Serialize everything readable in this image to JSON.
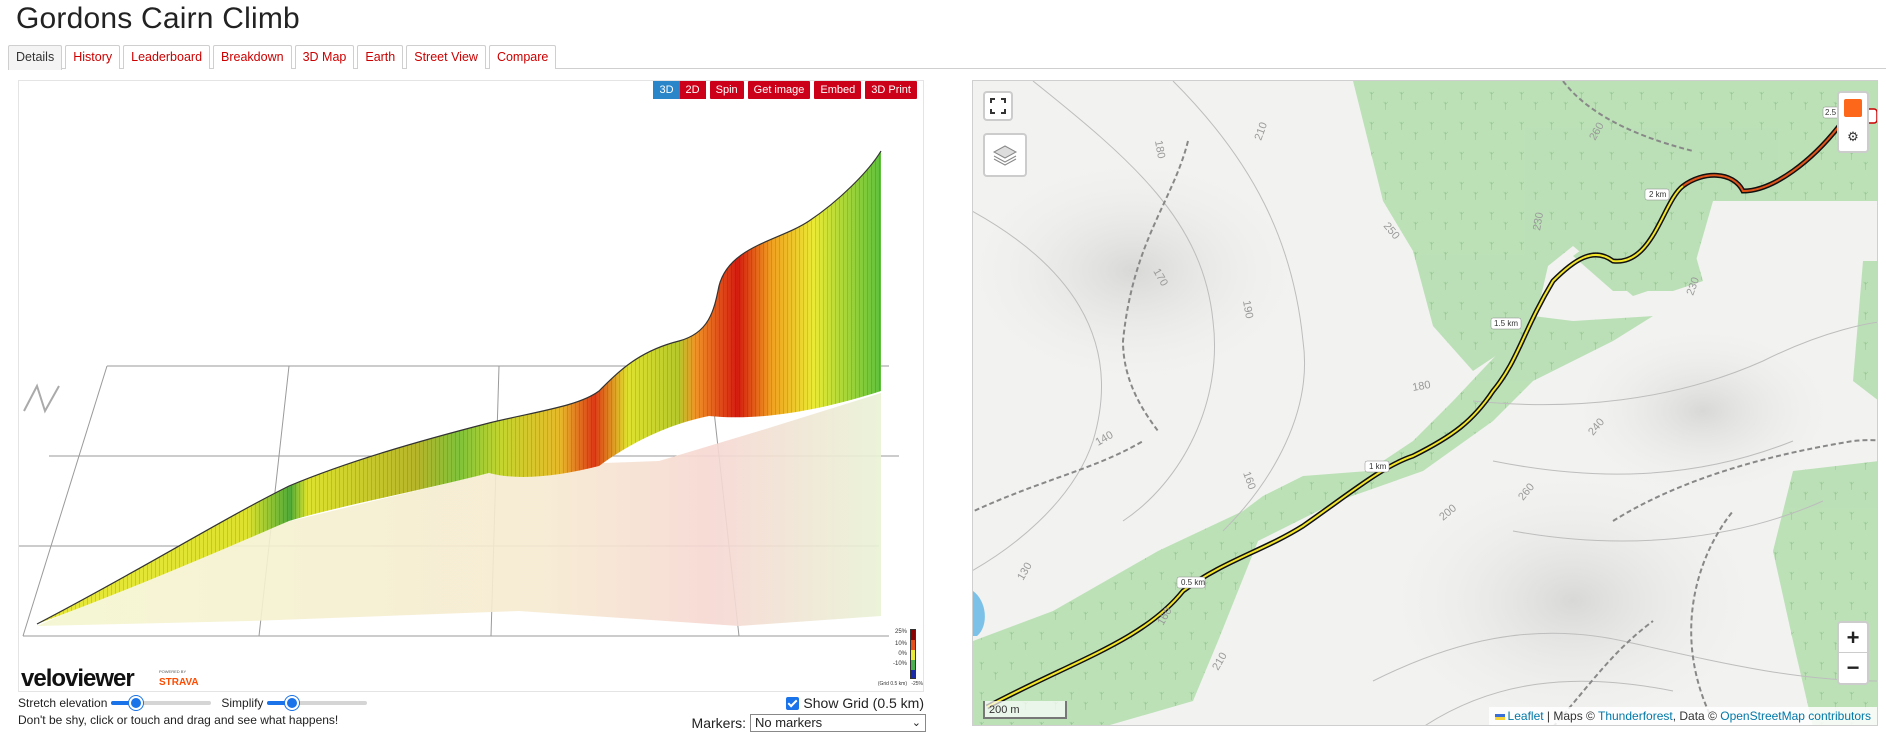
{
  "page": {
    "title": "Gordons Cairn Climb"
  },
  "tabs": [
    {
      "label": "Details",
      "active": true
    },
    {
      "label": "History"
    },
    {
      "label": "Leaderboard"
    },
    {
      "label": "Breakdown"
    },
    {
      "label": "3D Map"
    },
    {
      "label": "Earth"
    },
    {
      "label": "Street View"
    },
    {
      "label": "Compare"
    }
  ],
  "profile": {
    "buttons": {
      "three_d": "3D",
      "two_d": "2D",
      "spin": "Spin",
      "get_image": "Get image",
      "embed": "Embed",
      "print_3d": "3D Print"
    },
    "logo_text": "veloviewer",
    "powered_by": "POWERED BY",
    "strava": "STRAVA",
    "legend": {
      "top": "25%",
      "mid1": "10%",
      "mid2": "0%",
      "mid3": "-10%",
      "bottom": "-25%",
      "grid_note": "(Grid 0.5 km)"
    },
    "colors": {
      "accent_red": "#cc0019",
      "accent_blue": "#2a86c8"
    }
  },
  "controls": {
    "stretch_label": "Stretch elevation",
    "simplify_label": "Simplify",
    "stretch_value": 0.25,
    "simplify_value": 0.25,
    "hint": "Don't be shy, click or touch and drag and see what happens!",
    "show_grid_label": "Show Grid (0.5 km)",
    "show_grid_checked": true,
    "markers_label": "Markers:",
    "markers_value": "No markers"
  },
  "map": {
    "km_markers": [
      "0.5 km",
      "1 km",
      "1.5 km",
      "2 km",
      "2.5"
    ],
    "contour_labels": [
      "180",
      "210",
      "170",
      "190",
      "250",
      "230",
      "260",
      "230",
      "180",
      "140",
      "160",
      "240",
      "200",
      "260",
      "130",
      "160",
      "210"
    ],
    "scale": "200 m",
    "zoom_in": "+",
    "zoom_out": "−",
    "attribution": {
      "leaflet": "Leaflet",
      "sep1": " | Maps © ",
      "thunderforest": "Thunderforest",
      "sep2": ", Data © ",
      "osm": "OpenStreetMap contributors"
    },
    "icons": {
      "fullscreen": "fullscreen-icon",
      "layers": "layers-icon",
      "settings": "gear-icon",
      "zwift": "zwift-icon"
    }
  }
}
